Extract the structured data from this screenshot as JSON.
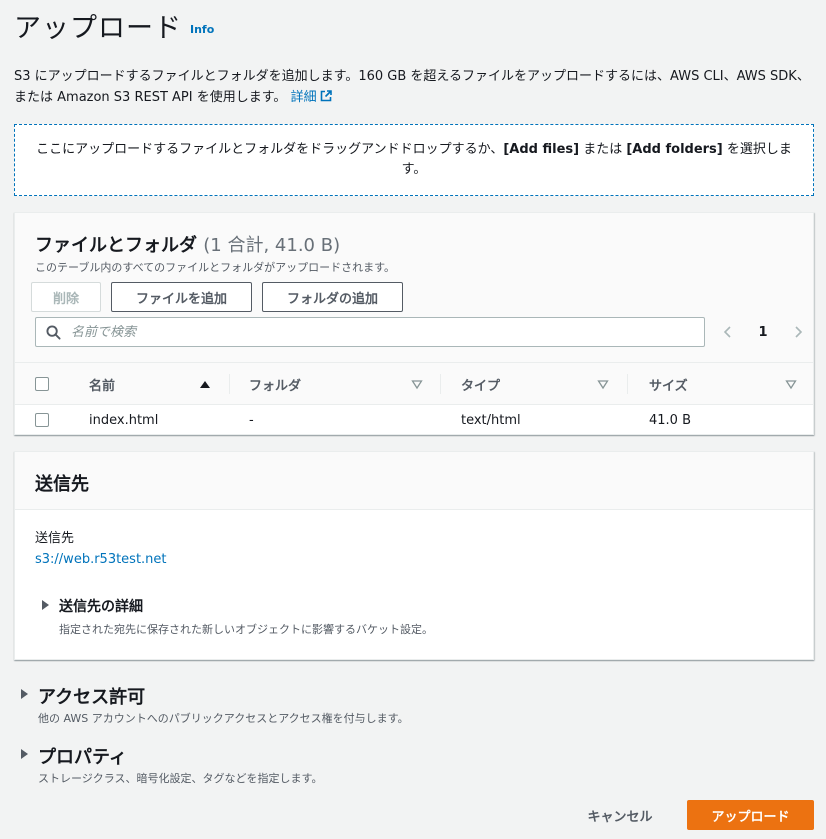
{
  "header": {
    "title": "アップロード",
    "info_label": "Info"
  },
  "description": {
    "text": "S3 にアップロードするファイルとフォルダを追加します。160 GB を超えるファイルをアップロードするには、AWS CLI、AWS SDK、または Amazon S3 REST API を使用します。",
    "link_label": "詳細"
  },
  "dropzone": {
    "prefix": "ここにアップロードするファイルとフォルダをドラッグアンドドロップするか、",
    "add_files": "[Add files]",
    "middle": " または ",
    "add_folders": "[Add folders]",
    "suffix": " を選択します。"
  },
  "files": {
    "title": "ファイルとフォルダ",
    "count": "(1 合計, 41.0 B)",
    "subtitle": "このテーブル内のすべてのファイルとフォルダがアップロードされます。",
    "delete_label": "削除",
    "add_files_label": "ファイルを追加",
    "add_folder_label": "フォルダの追加",
    "search_placeholder": "名前で検索",
    "page_number": "1",
    "columns": {
      "name": "名前",
      "folder": "フォルダ",
      "type": "タイプ",
      "size": "サイズ"
    },
    "rows": [
      {
        "name": "index.html",
        "folder": "-",
        "type": "text/html",
        "size": "41.0 B"
      }
    ]
  },
  "destination": {
    "title": "送信先",
    "label": "送信先",
    "link": "s3://web.r53test.net",
    "details_title": "送信先の詳細",
    "details_sub": "指定された宛先に保存された新しいオブジェクトに影響するバケット設定。"
  },
  "permissions": {
    "title": "アクセス許可",
    "sub": "他の AWS アカウントへのパブリックアクセスとアクセス権を付与します。"
  },
  "properties": {
    "title": "プロパティ",
    "sub": "ストレージクラス、暗号化設定、タグなどを指定します。"
  },
  "footer": {
    "cancel_label": "キャンセル",
    "upload_label": "アップロード"
  },
  "colors": {
    "link": "#0073bb",
    "primary": "#ec7211",
    "background": "#f2f3f3"
  }
}
